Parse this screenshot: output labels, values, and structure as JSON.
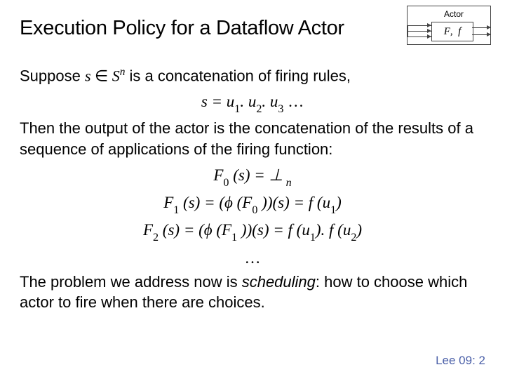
{
  "title": "Execution Policy for a Dataflow Actor",
  "figure": {
    "label": "Actor",
    "box_F": "F",
    "box_f": "f"
  },
  "suppose": {
    "prefix": "Suppose ",
    "s": "s",
    "in": " ∈ ",
    "S": "S",
    "n": "n",
    "rest": "  is a concatenation of firing rules,"
  },
  "eq_s": {
    "lhs": "s = u",
    "sub1": "1",
    "dot1": ". u",
    "sub2": "2",
    "dot2": ". u",
    "sub3": "3",
    "dots": "   …"
  },
  "then": "Then the output of the actor is the concatenation of the results of a sequence of applications of the firing function:",
  "F0": {
    "L": "F",
    "sub": "0",
    "mid": " (s) = ⊥",
    "tailsub": " n"
  },
  "F1": {
    "L": "F",
    "sub": "1",
    "a": " (s) = (ϕ (F",
    "sub0": "0",
    "b": " ))(s) = f (u",
    "sub1": "1",
    "c": ")"
  },
  "F2": {
    "L": "F",
    "sub": "2",
    "a": " (s) = (ϕ (F",
    "sub1": "1",
    "b": " ))(s) = f (u",
    "subu1": "1",
    "c": "). f (u",
    "subu2": "2",
    "d": ")"
  },
  "ell": "…",
  "problem": {
    "a": "The problem we address now is ",
    "b": "scheduling",
    "c": ": how to choose which actor to fire when there are choices."
  },
  "footer": "Lee 09: 2"
}
